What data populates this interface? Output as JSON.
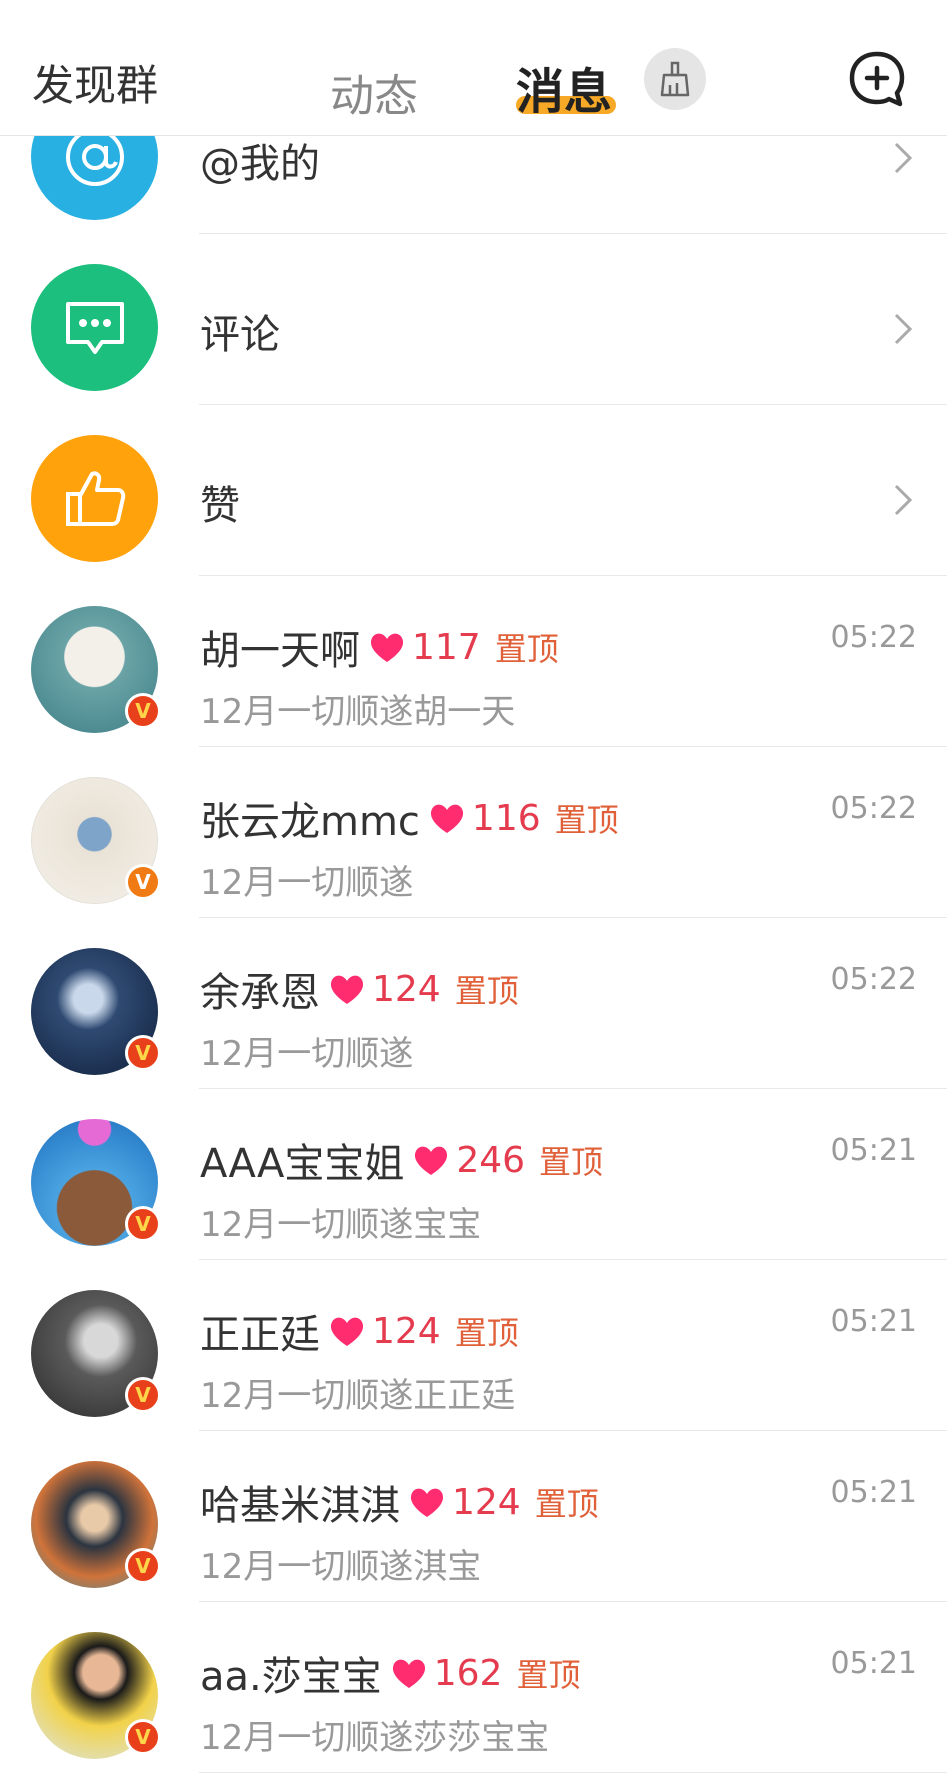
{
  "header": {
    "discover": "发现群",
    "tab_dynamic": "动态",
    "tab_messages": "消息",
    "broom_icon": "broom-icon",
    "add_chat_icon": "add-chat-icon"
  },
  "system_items": [
    {
      "label": "@我的",
      "icon": "at-icon",
      "color": "#29b0e3"
    },
    {
      "label": "评论",
      "icon": "comment-icon",
      "color": "#1cbf7d"
    },
    {
      "label": "赞",
      "icon": "thumbs-up-icon",
      "color": "#ffa20c"
    }
  ],
  "conversations": [
    {
      "name": "胡一天啊",
      "count": "117",
      "pin": "置顶",
      "time": "05:22",
      "preview": "12月一切顺遂胡一天"
    },
    {
      "name": "张云龙mmc",
      "count": "116",
      "pin": "置顶",
      "time": "05:22",
      "preview": "12月一切顺遂"
    },
    {
      "name": "余承恩",
      "count": "124",
      "pin": "置顶",
      "time": "05:22",
      "preview": "12月一切顺遂"
    },
    {
      "name": "AAA宝宝姐",
      "count": "246",
      "pin": "置顶",
      "time": "05:21",
      "preview": "12月一切顺遂宝宝"
    },
    {
      "name": "正正廷",
      "count": "124",
      "pin": "置顶",
      "time": "05:21",
      "preview": "12月一切顺遂正正廷"
    },
    {
      "name": "哈基米淇淇",
      "count": "124",
      "pin": "置顶",
      "time": "05:21",
      "preview": "12月一切顺遂淇宝"
    },
    {
      "name": "aa.莎宝宝",
      "count": "162",
      "pin": "置顶",
      "time": "05:21",
      "preview": "12月一切顺遂莎莎宝宝"
    }
  ],
  "verified_badge": "V",
  "colors": {
    "accent": "#f6a826",
    "count": "#e53b4e",
    "pin": "#e0603a",
    "heart": "#ff2d6f"
  }
}
